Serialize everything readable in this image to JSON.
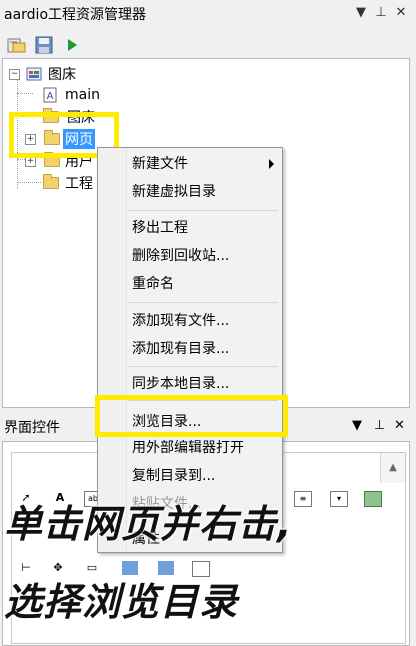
{
  "explorer": {
    "title": "aardio工程资源管理器",
    "pin_symbol": "▼",
    "pin2_symbol": "⊥",
    "close_symbol": "✕"
  },
  "tree": {
    "root_label": "图床",
    "items": [
      {
        "label": "main",
        "icon": "aardio-file-icon"
      },
      {
        "label": "图床",
        "icon": "folder-icon"
      },
      {
        "label": "网页",
        "icon": "folder-icon",
        "selected": true
      },
      {
        "label": "用户",
        "icon": "folder-icon"
      },
      {
        "label": "工程",
        "icon": "folder-icon"
      }
    ]
  },
  "context_menu": {
    "items": [
      {
        "label": "新建文件",
        "submenu": true
      },
      {
        "label": "新建虚拟目录"
      },
      {
        "label": "移出工程"
      },
      {
        "label": "删除到回收站..."
      },
      {
        "label": "重命名"
      },
      {
        "label": "添加现有文件..."
      },
      {
        "label": "添加现有目录..."
      },
      {
        "label": "同步本地目录..."
      },
      {
        "label": "浏览目录..."
      },
      {
        "label": "用外部编辑器打开"
      },
      {
        "label": "复制目录到..."
      },
      {
        "label": "粘贴文件..."
      },
      {
        "label": "属性"
      }
    ]
  },
  "controls_pane": {
    "title": "界面控件",
    "pin_symbol": "▼",
    "pin2_symbol": "⊥",
    "close_symbol": "✕",
    "scroll_up": "▲"
  },
  "caption": {
    "line1": "单击网页并右击,",
    "line2": "选择浏览目录"
  },
  "colors": {
    "highlight": "#ffeb00",
    "selection": "#3399ff"
  }
}
